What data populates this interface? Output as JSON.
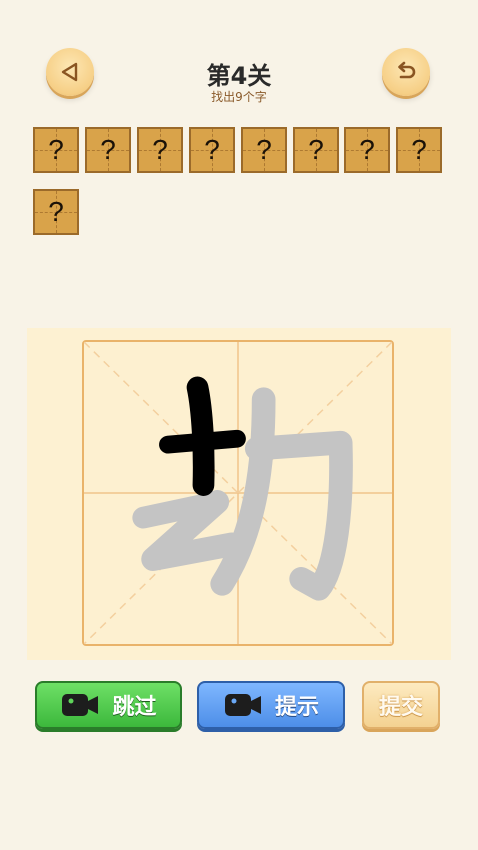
{
  "header": {
    "title": "第4关",
    "subtitle": "找出9个字",
    "back_icon": "back-triangle-icon",
    "restart_icon": "undo-arrow-icon"
  },
  "slots": [
    "?",
    "?",
    "?",
    "?",
    "?",
    "?",
    "?",
    "?",
    "?"
  ],
  "puzzle": {
    "character": "劫",
    "highlighted_stroke_color": "#000000",
    "remaining_stroke_color": "#c4c4c4"
  },
  "buttons": {
    "skip_label": "跳过",
    "hint_label": "提示",
    "submit_label": "提交"
  },
  "colors": {
    "background": "#f8f3e7",
    "slot": "#d9a34a",
    "skip": "#3cb83c",
    "hint": "#4d8ee8",
    "submit": "#f4d291"
  }
}
